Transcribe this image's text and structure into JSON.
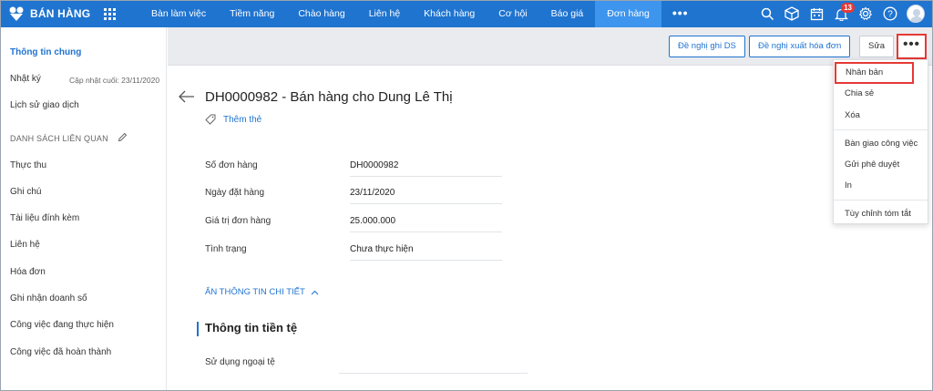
{
  "brand": {
    "name": "BÁN HÀNG"
  },
  "nav": {
    "items": [
      "Bàn làm việc",
      "Tiềm năng",
      "Chào hàng",
      "Liên hệ",
      "Khách hàng",
      "Cơ hội",
      "Báo giá",
      "Đơn hàng"
    ],
    "active_index": 7,
    "more": "•••"
  },
  "topbar_icons": {
    "search": "search-icon",
    "box": "box-icon",
    "calendar": "calendar-icon",
    "notification_count": "13",
    "settings": "gear-icon",
    "help": "?"
  },
  "sidebar": {
    "general": "Thông tin chung",
    "log": "Nhật ký",
    "last_updated": "Cập nhật cuối: 23/11/2020",
    "history": "Lịch sử giao dịch",
    "related_heading": "DANH SÁCH LIÊN QUAN",
    "related_items": [
      "Thực thu",
      "Ghi chú",
      "Tài liệu đính kèm",
      "Liên hệ",
      "Hóa đơn",
      "Ghi nhận doanh số",
      "Công việc đang thực hiện",
      "Công việc đã hoàn thành"
    ]
  },
  "actions": {
    "propose_ds": "Đề nghị ghi DS",
    "propose_invoice": "Đề nghị xuất hóa đơn",
    "edit": "Sửa",
    "more": "•••"
  },
  "record": {
    "title": "DH0000982 - Bán hàng cho Dung Lê Thị",
    "add_tag": "Thêm thẻ",
    "fields": [
      {
        "label": "Số đơn hàng",
        "value": "DH0000982"
      },
      {
        "label": "Ngày đặt hàng",
        "value": "23/11/2020"
      },
      {
        "label": "Giá trị đơn hàng",
        "value": "25.000.000"
      },
      {
        "label": "Tình trạng",
        "value": "Chưa thực hiện"
      }
    ],
    "hide_details": "ẨN THÔNG TIN CHI TIẾT",
    "currency_section": "Thông tin tiền tệ",
    "currency_field": {
      "label": "Sử dụng ngoại tệ",
      "value": ""
    }
  },
  "dropdown": {
    "items": [
      "Nhân bản",
      "Chia sẻ",
      "Xóa",
      "Bàn giao công việc",
      "Gửi phê duyệt",
      "In",
      "Tùy chỉnh tóm tắt"
    ],
    "highlight_color": "#e53935"
  },
  "colors": {
    "primary": "#1f74d0",
    "active_tab": "#3d95ee",
    "highlight": "#e53935"
  }
}
